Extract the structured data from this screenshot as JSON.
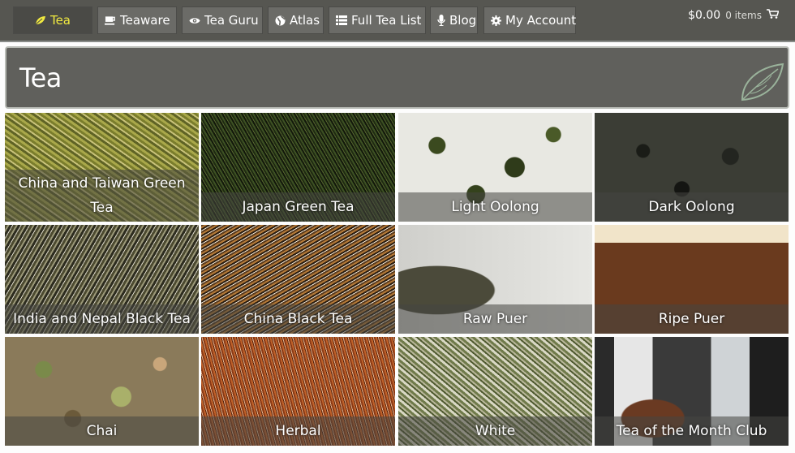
{
  "nav": {
    "items": [
      {
        "label": "Tea",
        "icon": "leaf-icon",
        "active": true
      },
      {
        "label": "Teaware",
        "icon": "teacup-icon"
      },
      {
        "label": "Tea Guru",
        "icon": "eye-icon"
      },
      {
        "label": "Atlas",
        "icon": "globe-icon"
      },
      {
        "label": "Full Tea List",
        "icon": "list-icon"
      },
      {
        "label": "Blog",
        "icon": "microphone-icon"
      },
      {
        "label": "My Account",
        "icon": "gear-icon"
      }
    ],
    "cart": {
      "total": "$0.00",
      "items": "0 items",
      "icon": "cart-icon"
    }
  },
  "page": {
    "title": "Tea"
  },
  "categories": [
    {
      "label": "China and Taiwan Green Tea"
    },
    {
      "label": "Japan Green Tea"
    },
    {
      "label": "Light Oolong"
    },
    {
      "label": "Dark Oolong"
    },
    {
      "label": "India and Nepal Black Tea"
    },
    {
      "label": "China Black Tea"
    },
    {
      "label": "Raw Puer"
    },
    {
      "label": "Ripe Puer"
    },
    {
      "label": "Chai"
    },
    {
      "label": "Herbal"
    },
    {
      "label": "White"
    },
    {
      "label": "Tea of the Month Club"
    }
  ],
  "colors": {
    "topbar": "#565651",
    "active_text": "#f1ea40",
    "panel": "#60605c"
  }
}
